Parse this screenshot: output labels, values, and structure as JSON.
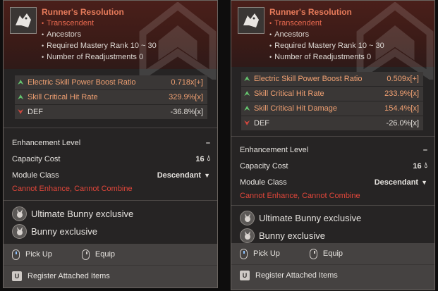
{
  "cards": [
    {
      "title": "Runner's Resolution",
      "tier": "Transcendent",
      "lines": [
        "Ancestors",
        "Required Mastery Rank 10 ~ 30",
        "Number of Readjustments 0"
      ],
      "stats": [
        {
          "dir": "up",
          "name": "Electric Skill Power Boost Ratio",
          "value": "0.718x[+]"
        },
        {
          "dir": "up",
          "name": "Skill Critical Hit Rate",
          "value": "329.9%[x]"
        },
        {
          "dir": "down",
          "name": "DEF",
          "value": "-36.8%[x]"
        }
      ],
      "enhancement_label": "Enhancement Level",
      "enhancement_value": "–",
      "capacity_label": "Capacity Cost",
      "capacity_value": "16",
      "module_label": "Module Class",
      "module_value": "Descendant",
      "warning": "Cannot Enhance, Cannot Combine",
      "exclusive": [
        "Ultimate Bunny exclusive",
        "Bunny exclusive"
      ],
      "pickup": "Pick Up",
      "equip": "Equip",
      "register_key": "U",
      "register": "Register Attached Items"
    },
    {
      "title": "Runner's Resolution",
      "tier": "Transcendent",
      "lines": [
        "Ancestors",
        "Required Mastery Rank 10 ~ 30",
        "Number of Readjustments 0"
      ],
      "stats": [
        {
          "dir": "up",
          "name": "Electric Skill Power Boost Ratio",
          "value": "0.509x[+]"
        },
        {
          "dir": "up",
          "name": "Skill Critical Hit Rate",
          "value": "233.9%[x]"
        },
        {
          "dir": "up",
          "name": "Skill Critical Hit Damage",
          "value": "154.4%[x]"
        },
        {
          "dir": "down",
          "name": "DEF",
          "value": "-26.0%[x]"
        }
      ],
      "enhancement_label": "Enhancement Level",
      "enhancement_value": "–",
      "capacity_label": "Capacity Cost",
      "capacity_value": "16",
      "module_label": "Module Class",
      "module_value": "Descendant",
      "warning": "Cannot Enhance, Cannot Combine",
      "exclusive": [
        "Ultimate Bunny exclusive",
        "Bunny exclusive"
      ],
      "pickup": "Pick Up",
      "equip": "Equip",
      "register_key": "U",
      "register": "Register Attached Items"
    }
  ],
  "colors": {
    "transcendent": "#e8694f",
    "buff": "#65c46e",
    "debuff": "#d0473e",
    "warning": "#e0463a"
  },
  "icons": {
    "module": "wolf-emblem-icon",
    "stat_up": "double-chevron-up-icon",
    "stat_down": "double-chevron-down-icon",
    "capacity": "droplet-icon",
    "module_class": "descendant-class-icon",
    "avatar": "bunny-avatar-icon",
    "mouse_left": "mouse-left-click-icon",
    "mouse_right": "mouse-right-click-icon"
  }
}
